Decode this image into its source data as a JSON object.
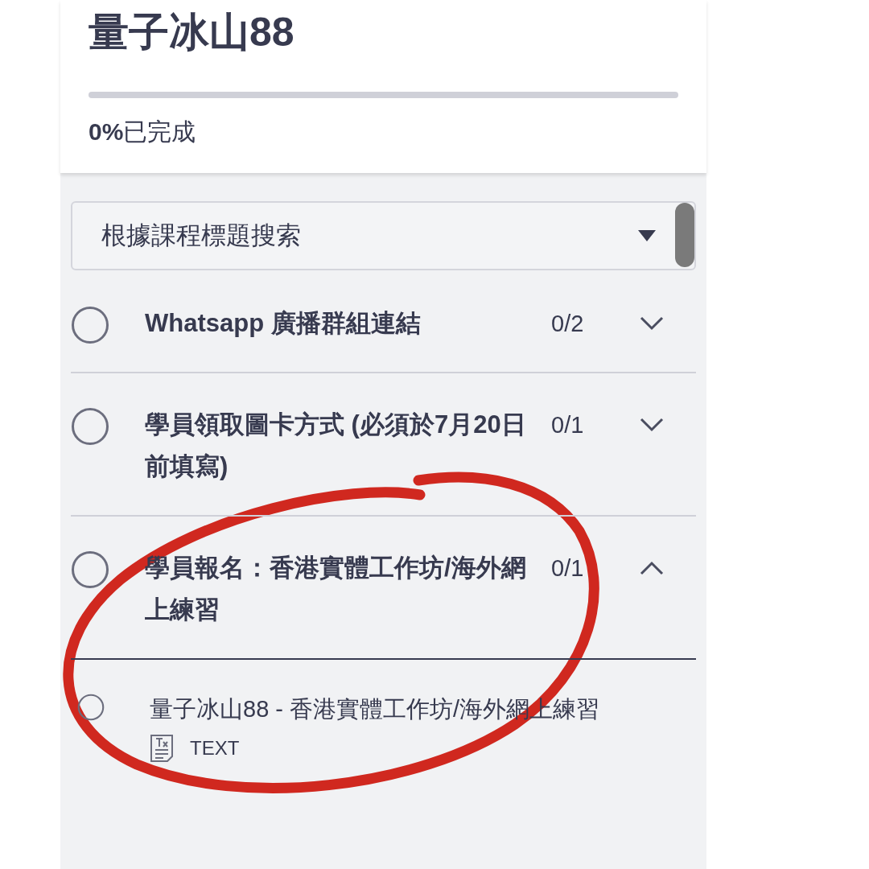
{
  "course": {
    "title": "量子冰山88",
    "progress": {
      "level": 0
    },
    "progress_label": "**0%**已完成"
  },
  "search": {
    "placeholder": "根據課程標題搜索"
  },
  "sections": [
    {
      "title": "Whatsapp 廣播群組連結",
      "count": "0/2",
      "completed": false,
      "expanded": false
    },
    {
      "title": "學員領取圖卡方式 (必須於7月20日前填寫)",
      "count": "0/1",
      "completed": false,
      "expanded": false
    },
    {
      "title": "學員報名：香港實體工作坊/海外網上練習",
      "count": "0/1",
      "completed": false,
      "expanded": true,
      "lessons": [
        {
          "title": "量子冰山88 - 香港實體工作坊/海外網上練習",
          "type": "TEXT",
          "completed": false
        }
      ]
    }
  ]
}
